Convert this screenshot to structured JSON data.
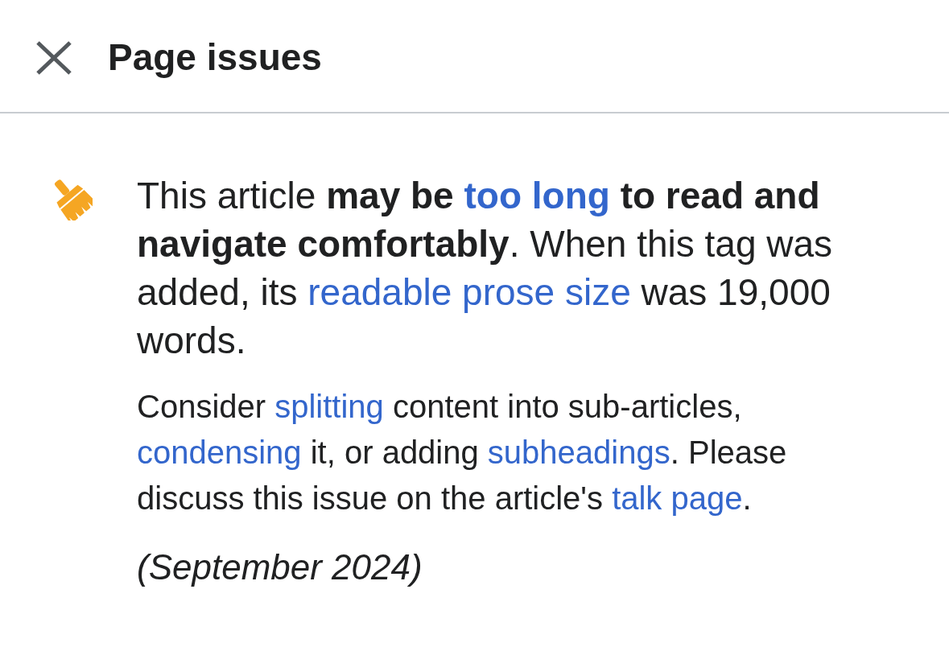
{
  "header": {
    "title": "Page issues"
  },
  "issues": [
    {
      "summary": [
        {
          "kind": "text",
          "text": "This article **may be** "
        },
        {
          "kind": "link",
          "text": "too long",
          "bold": true
        },
        {
          "kind": "text",
          "text": " **to read and navigate comfortably**. When this tag was added, its "
        },
        {
          "kind": "link",
          "text": "readable prose size",
          "bold": false
        },
        {
          "kind": "text",
          "text": " was 19,000 words."
        }
      ],
      "details": [
        {
          "kind": "text",
          "text": "Consider "
        },
        {
          "kind": "link",
          "text": "splitting",
          "bold": false
        },
        {
          "kind": "text",
          "text": " content into sub-articles, "
        },
        {
          "kind": "link",
          "text": "condensing",
          "bold": false
        },
        {
          "kind": "text",
          "text": " it, or adding "
        },
        {
          "kind": "link",
          "text": "subheadings",
          "bold": false
        },
        {
          "kind": "text",
          "text": ". Please discuss this issue on the article's "
        },
        {
          "kind": "link",
          "text": "talk page",
          "bold": false
        },
        {
          "kind": "text",
          "text": "."
        }
      ],
      "date": "(September 2024)"
    }
  ]
}
